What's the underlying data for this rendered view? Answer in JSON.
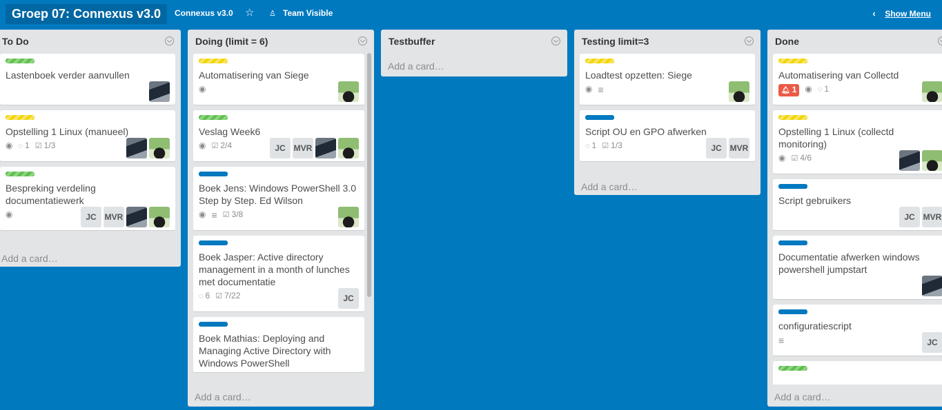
{
  "header": {
    "board_name": "Groep 07: Connexus v3.0",
    "org_name": "Connexus v3.0",
    "visibility": "Team Visible",
    "show_menu": "Show Menu"
  },
  "lists": [
    {
      "title": "To Do",
      "add_card": "Add a card…",
      "cards": [
        {
          "labels": [
            "green"
          ],
          "title": "Lastenboek verder aanvullen",
          "members": [
            "avatar-a"
          ]
        },
        {
          "labels": [
            "yellow"
          ],
          "title": "Opstelling 1 Linux (manueel)",
          "watch": true,
          "comments": "1",
          "checklist": "1/3",
          "members": [
            "avatar-a",
            "avatar-b"
          ]
        },
        {
          "labels": [
            "green"
          ],
          "title": "Bespreking verdeling documentatiewerk",
          "watch": true,
          "members": [
            "JC",
            "MVR",
            "avatar-a",
            "avatar-b"
          ]
        }
      ]
    },
    {
      "title": "Doing (limit = 6)",
      "add_card": "Add a card…",
      "cards": [
        {
          "labels": [
            "yellow"
          ],
          "title": "Automatisering van Siege",
          "watch": true,
          "members": [
            "avatar-b"
          ]
        },
        {
          "labels": [
            "green"
          ],
          "title": "Veslag Week6",
          "watch": true,
          "checklist": "2/4",
          "members": [
            "JC",
            "MVR",
            "avatar-a",
            "avatar-b"
          ]
        },
        {
          "labels": [
            "blue"
          ],
          "title": "Boek Jens: Windows PowerShell 3.0 Step by Step. Ed Wilson",
          "watch": true,
          "description": true,
          "checklist": "3/8",
          "members": [
            "avatar-b"
          ]
        },
        {
          "labels": [
            "blue"
          ],
          "title": "Boek Jasper: Active directory management in a month of lunches met documentatie",
          "comments": "6",
          "checklist": "7/22",
          "members": [
            "JC"
          ]
        },
        {
          "labels": [
            "blue"
          ],
          "title": "Boek Mathias: Deploying and Managing Active Directory with Windows PowerShell",
          "members": []
        }
      ]
    },
    {
      "title": "Testbuffer",
      "add_card": "Add a card…",
      "cards": []
    },
    {
      "title": "Testing limit=3",
      "add_card": "Add a card…",
      "cards": [
        {
          "labels": [
            "yellow"
          ],
          "title": "Loadtest opzetten: Siege",
          "watch": true,
          "description": true,
          "members": [
            "avatar-b"
          ]
        },
        {
          "labels": [
            "blue"
          ],
          "title": "Script OU en GPO afwerken",
          "comments": "1",
          "checklist": "1/3",
          "members": [
            "JC",
            "MVR"
          ]
        }
      ]
    },
    {
      "title": "Done",
      "add_card": "Add a card…",
      "cards": [
        {
          "labels": [
            "yellow"
          ],
          "title": "Automatisering van Collectd",
          "notifications": "1",
          "watch": true,
          "comments": "1",
          "members": [
            "avatar-b"
          ]
        },
        {
          "labels": [
            "yellow"
          ],
          "title": "Opstelling 1 Linux (collectd monitoring)",
          "watch": true,
          "checklist": "4/6",
          "members": [
            "avatar-a",
            "avatar-b"
          ]
        },
        {
          "labels": [
            "blue"
          ],
          "title": "Script gebruikers",
          "members": [
            "JC",
            "MVR"
          ]
        },
        {
          "labels": [
            "blue"
          ],
          "title": "Documentatie afwerken windows powershell jumpstart",
          "members": [
            "avatar-a"
          ]
        },
        {
          "labels": [
            "blue"
          ],
          "title": "configuratiescript",
          "description": true,
          "members": [
            "JC"
          ]
        },
        {
          "labels": [
            "green"
          ],
          "title": "",
          "members": []
        }
      ]
    }
  ],
  "colors": {
    "board_bg": "#0079bf",
    "list_bg": "#e2e4e6",
    "label_green": "#61bd4f",
    "label_yellow": "#f2d600",
    "label_blue": "#0079bf",
    "notif_red": "#eb5a46"
  },
  "icons": {
    "star": "star-icon",
    "visibility": "team-icon",
    "menu": "chevron-left-icon",
    "watch": "eye-icon",
    "comments": "comment-icon",
    "checklist": "checklist-icon",
    "description": "description-icon",
    "notifications": "bell-icon"
  }
}
